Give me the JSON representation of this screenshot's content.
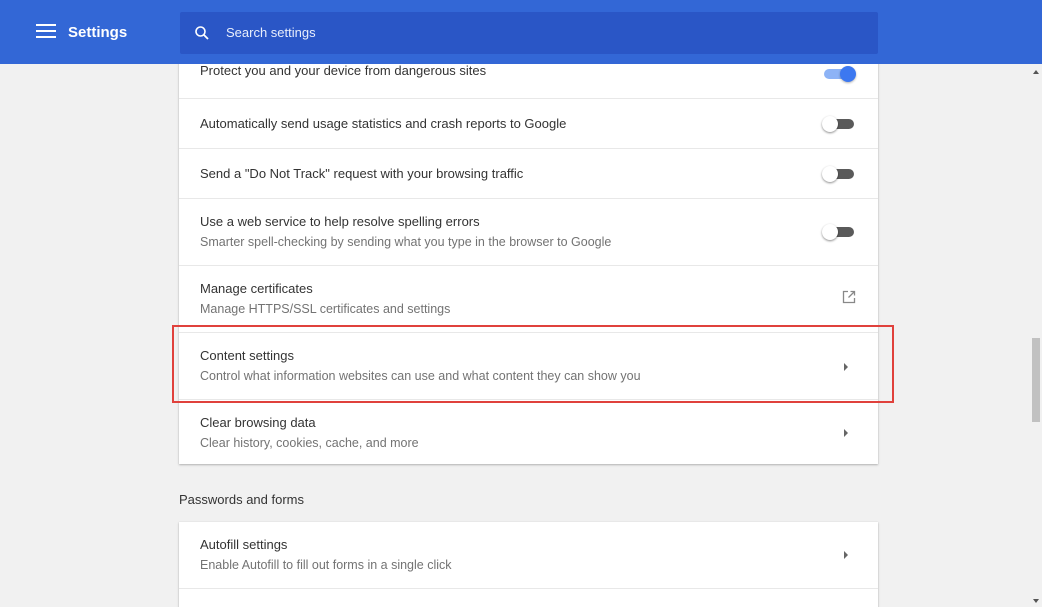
{
  "header": {
    "title": "Settings",
    "menu_icon": "hamburger-menu-icon",
    "search_placeholder": "Search settings",
    "search_icon": "search-icon",
    "colors": {
      "header_bg": "#3367d6",
      "search_bg": "#2a56c6"
    }
  },
  "privacy_card": {
    "rows": [
      {
        "primary": "Protect you and your device from dangerous sites",
        "control": "toggle",
        "state": "on"
      },
      {
        "primary": "Automatically send usage statistics and crash reports to Google",
        "control": "toggle",
        "state": "off"
      },
      {
        "primary": "Send a \"Do Not Track\" request with your browsing traffic",
        "control": "toggle",
        "state": "off"
      },
      {
        "primary": "Use a web service to help resolve spelling errors",
        "secondary": "Smarter spell-checking by sending what you type in the browser to Google",
        "control": "toggle",
        "state": "off"
      },
      {
        "primary": "Manage certificates",
        "secondary": "Manage HTTPS/SSL certificates and settings",
        "control": "open-in-new-icon"
      },
      {
        "primary": "Content settings",
        "secondary": "Control what information websites can use and what content they can show you",
        "control": "chevron-right-icon",
        "highlighted": true
      },
      {
        "primary": "Clear browsing data",
        "secondary": "Clear history, cookies, cache, and more",
        "control": "chevron-right-icon"
      }
    ]
  },
  "passwords_section": {
    "title": "Passwords and forms",
    "rows": [
      {
        "primary": "Autofill settings",
        "secondary": "Enable Autofill to fill out forms in a single click",
        "control": "chevron-right-icon"
      }
    ]
  },
  "colors": {
    "accent": "#3c78f0",
    "highlight_border": "#e0413c",
    "page_bg": "#f1f1f1"
  }
}
